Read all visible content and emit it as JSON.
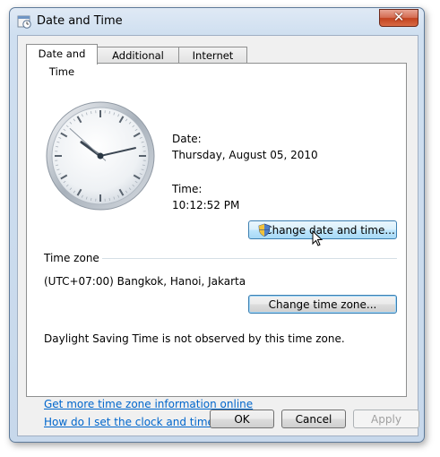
{
  "window": {
    "title": "Date and Time",
    "icon": "date-time-app-icon",
    "close_label": "✕"
  },
  "tabs": [
    {
      "label": "Date and Time",
      "active": true
    },
    {
      "label": "Additional Clocks",
      "active": false
    },
    {
      "label": "Internet Time",
      "active": false
    }
  ],
  "clock": {
    "hours": 10,
    "minutes": 12,
    "seconds": 52
  },
  "date": {
    "label": "Date:",
    "value": "Thursday, August 05, 2010"
  },
  "time": {
    "label": "Time:",
    "value": "10:12:52 PM"
  },
  "change_datetime_button": "Change date and time...",
  "time_zone": {
    "section_label": "Time zone",
    "value": "(UTC+07:00) Bangkok, Hanoi, Jakarta",
    "change_button": "Change time zone...",
    "dst_note": "Daylight Saving Time is not observed by this time zone."
  },
  "links": {
    "more_info": "Get more time zone information online",
    "how_to_set": "How do I set the clock and time zone?"
  },
  "buttons": {
    "ok": "OK",
    "cancel": "Cancel",
    "apply": "Apply"
  }
}
